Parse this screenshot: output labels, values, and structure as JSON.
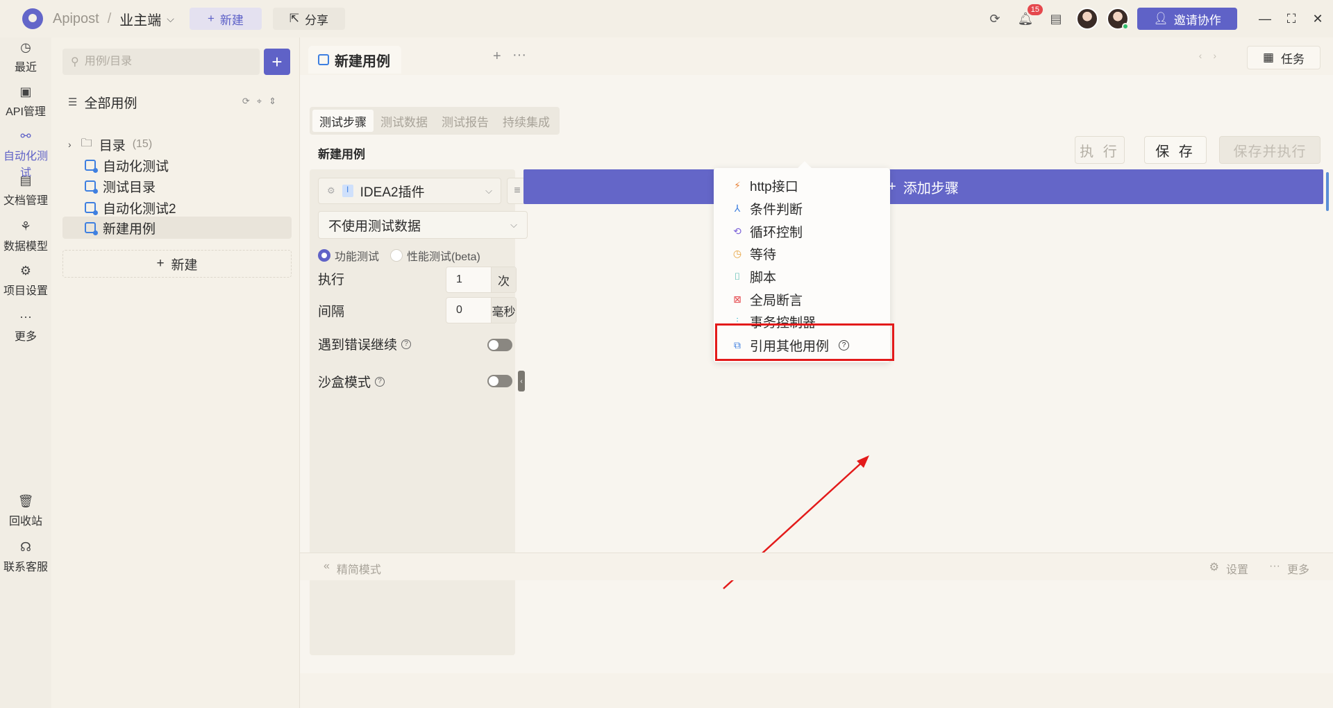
{
  "topbar": {
    "app_name": "Apipost",
    "separator": "/",
    "project": "业主端",
    "new_label": "新建",
    "share_label": "分享",
    "notification_count": "15",
    "invite_label": "邀请协作"
  },
  "rail": {
    "items": [
      {
        "label": "最近",
        "icon": "clock-icon"
      },
      {
        "label": "API管理",
        "icon": "api-icon"
      },
      {
        "label": "自动化测试",
        "icon": "automation-icon"
      },
      {
        "label": "文档管理",
        "icon": "document-icon"
      },
      {
        "label": "数据模型",
        "icon": "model-icon"
      },
      {
        "label": "项目设置",
        "icon": "settings-icon"
      },
      {
        "label": "更多",
        "icon": "more-icon"
      }
    ],
    "bottom": [
      {
        "label": "回收站",
        "icon": "trash-icon"
      },
      {
        "label": "联系客服",
        "icon": "headset-icon"
      }
    ]
  },
  "tree": {
    "search_placeholder": "用例/目录",
    "root_label": "全部用例",
    "folder_label": "目录",
    "folder_count": "(15)",
    "cases": [
      "自动化测试",
      "测试目录",
      "自动化测试2",
      "新建用例"
    ],
    "new_label": "新建"
  },
  "main": {
    "tab_title": "新建用例",
    "task_label": "任务",
    "subtabs": [
      "测试步骤",
      "测试数据",
      "测试报告",
      "持续集成"
    ],
    "case_title": "新建用例",
    "run_label": "执 行",
    "save_label": "保 存",
    "save_run_label": "保存并执行",
    "plugin_label": "IDEA2插件",
    "plugin_badge": "I",
    "data_select": "不使用测试数据",
    "radio_functional": "功能测试",
    "radio_perf": "性能测试(beta)",
    "exec_label": "执行",
    "exec_value": "1",
    "exec_unit": "次",
    "interval_label": "间隔",
    "interval_value": "0",
    "interval_unit": "毫秒",
    "continue_on_error": "遇到错误继续",
    "sandbox_mode": "沙盒模式",
    "add_step_label": "添加步骤"
  },
  "dropdown": {
    "items": [
      {
        "label": "http接口",
        "icon": "http-icon",
        "color": "#e8833a"
      },
      {
        "label": "条件判断",
        "icon": "branch-icon",
        "color": "#3e7fe0"
      },
      {
        "label": "循环控制",
        "icon": "loop-icon",
        "color": "#7b61d9"
      },
      {
        "label": "等待",
        "icon": "wait-icon",
        "color": "#e6a23c"
      },
      {
        "label": "脚本",
        "icon": "script-icon",
        "color": "#26a69a"
      },
      {
        "label": "全局断言",
        "icon": "assert-icon",
        "color": "#e5484d"
      },
      {
        "label": "事务控制器",
        "icon": "transaction-icon",
        "color": "#26b3c9"
      },
      {
        "label": "引用其他用例",
        "icon": "reference-case-icon",
        "color": "#3e7fe0"
      }
    ]
  },
  "bottom": {
    "simple_mode": "精简模式",
    "settings": "设置",
    "more": "更多"
  }
}
